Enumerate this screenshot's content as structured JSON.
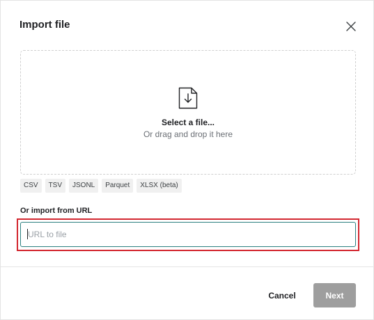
{
  "dialog": {
    "title": "Import file",
    "close_icon": "close-icon"
  },
  "dropzone": {
    "icon": "file-download-icon",
    "title": "Select a file...",
    "subtitle": "Or drag and drop it here"
  },
  "formats": [
    "CSV",
    "TSV",
    "JSONL",
    "Parquet",
    "XLSX (beta)"
  ],
  "url_import": {
    "label": "Or import from URL",
    "value": "",
    "placeholder": "URL to file"
  },
  "footer": {
    "cancel_label": "Cancel",
    "next_label": "Next"
  },
  "colors": {
    "highlight": "#d3262f",
    "input_border": "#2a7f7f",
    "next_button_bg": "#9e9e9e"
  }
}
